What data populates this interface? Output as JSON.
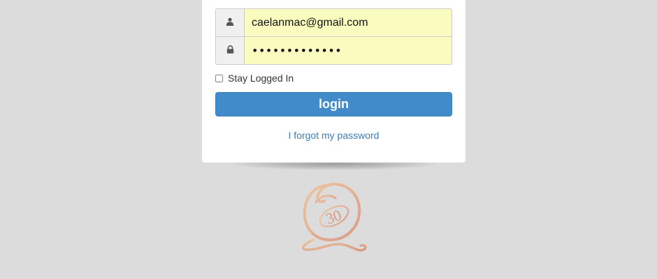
{
  "login_form": {
    "email_value": "caelanmac@gmail.com",
    "password_masked": "•••••••••••••",
    "stay_logged_in_label": "Stay Logged In",
    "stay_logged_in_checked": false,
    "login_button_label": "login",
    "forgot_password_link": "I forgot my password"
  },
  "logo": {
    "text": "30",
    "color": "#e0a98a"
  },
  "colors": {
    "background": "#dcdcdc",
    "card": "#ffffff",
    "autofill": "#fafcbf",
    "primary": "#428bca",
    "link": "#3a7dbb"
  },
  "icons": {
    "email_icon": "user-icon",
    "password_icon": "lock-icon"
  }
}
